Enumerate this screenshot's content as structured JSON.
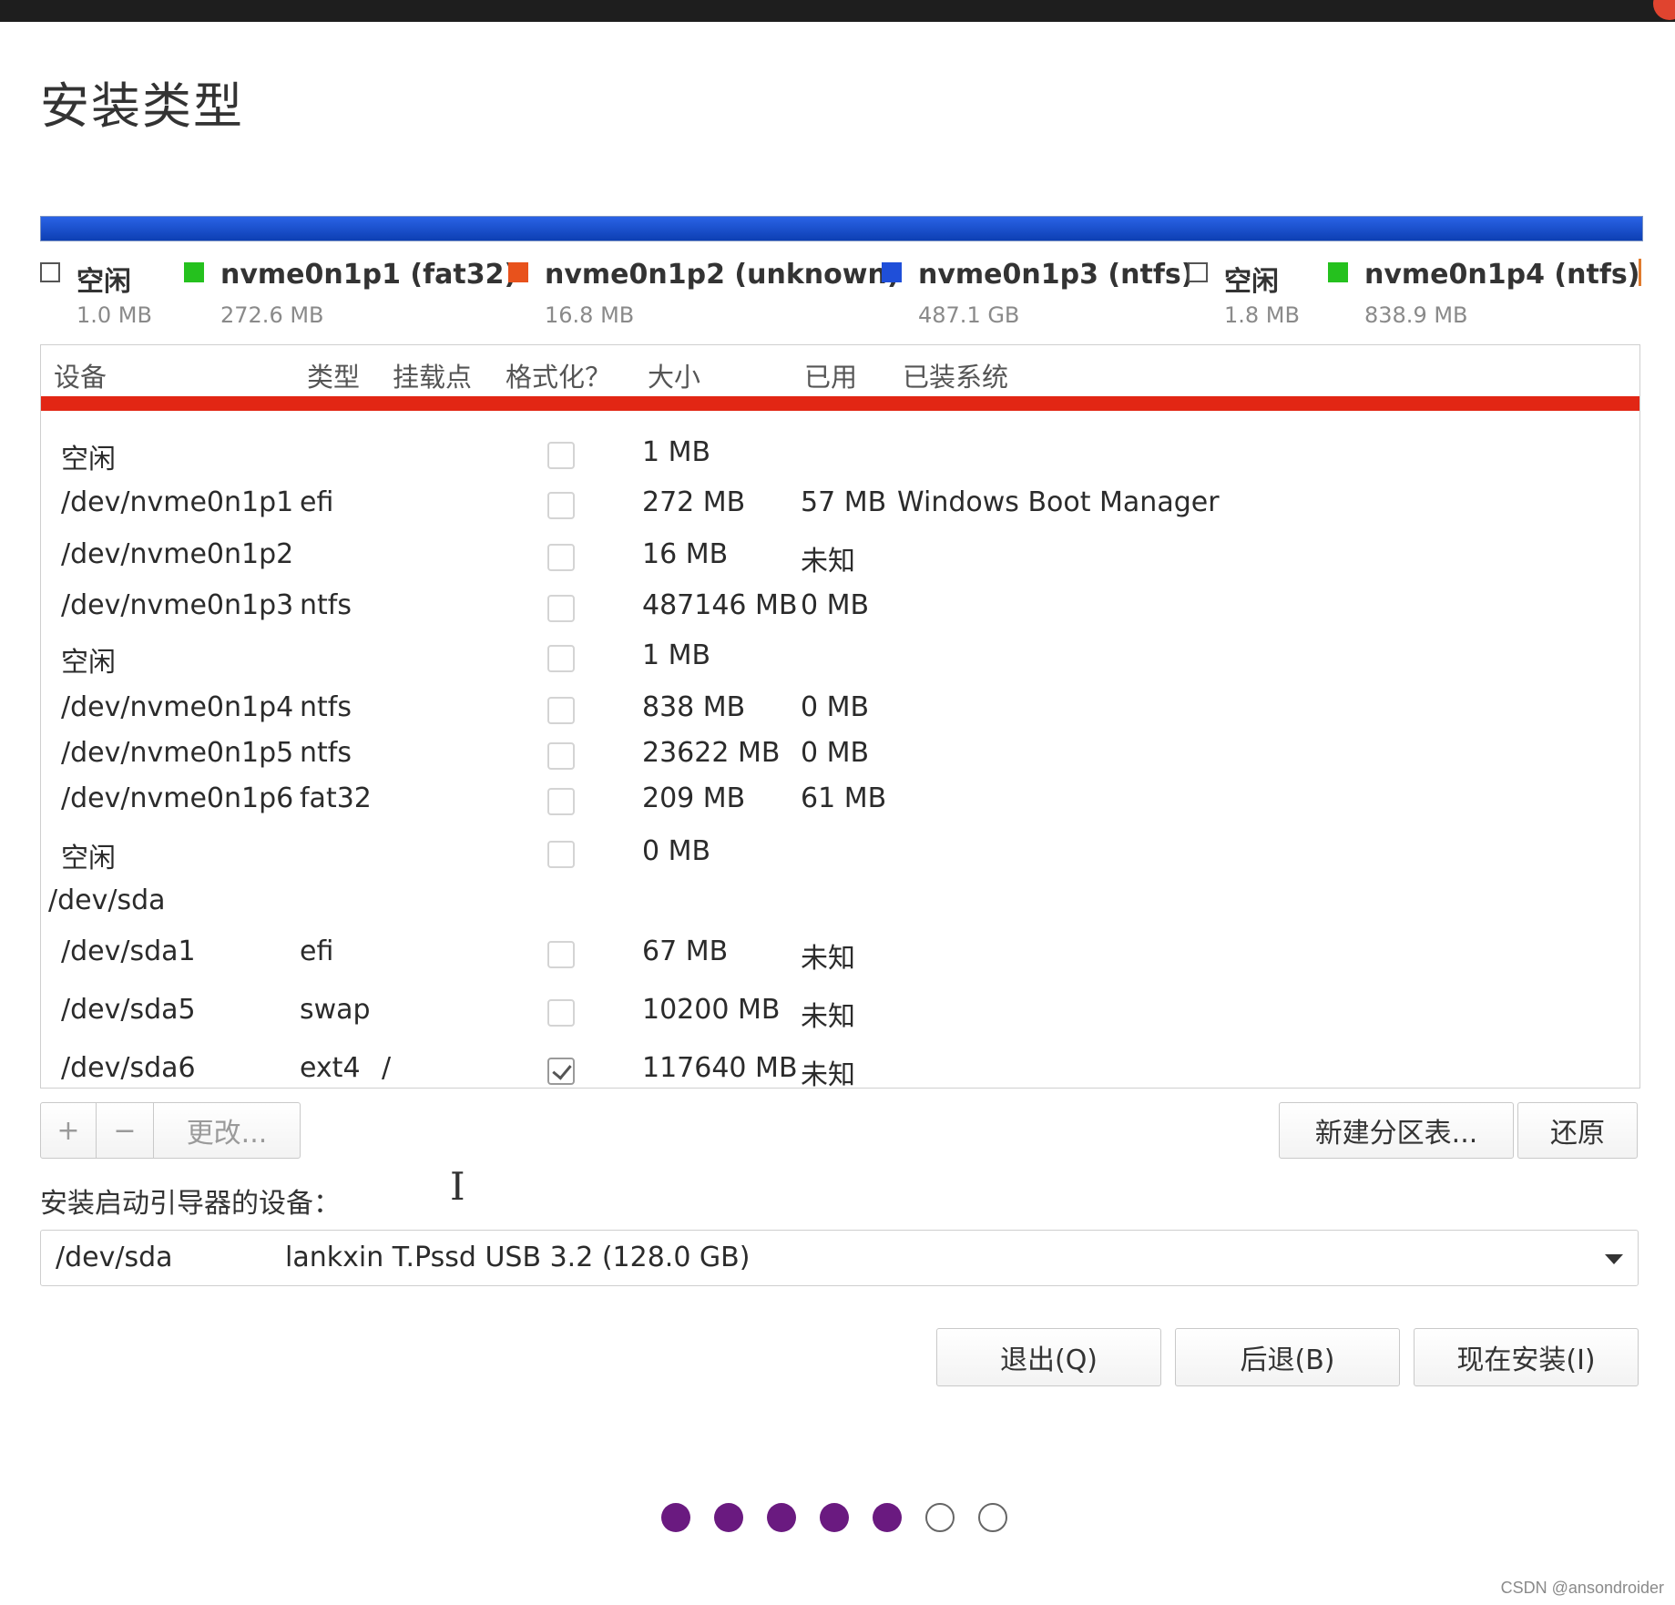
{
  "page": {
    "title": "安装类型"
  },
  "legend": [
    {
      "label": "空闲",
      "size": "1.0 MB",
      "color": "#ffffff",
      "free": true
    },
    {
      "label": "nvme0n1p1 (fat32)",
      "size": "272.6 MB",
      "color": "#25c11e",
      "free": false
    },
    {
      "label": "nvme0n1p2 (unknown)",
      "size": "16.8 MB",
      "color": "#e8521c",
      "free": false
    },
    {
      "label": "nvme0n1p3 (ntfs)",
      "size": "487.1 GB",
      "color": "#1f4fd9",
      "free": false
    },
    {
      "label": "空闲",
      "size": "1.8 MB",
      "color": "#ffffff",
      "free": true
    },
    {
      "label": "nvme0n1p4 (ntfs)",
      "size": "838.9 MB",
      "color": "#25c11e",
      "free": false
    }
  ],
  "table": {
    "headers": {
      "device": "设备",
      "type": "类型",
      "mount": "挂载点",
      "format": "格式化？",
      "size": "大小",
      "used": "已用",
      "system": "已装系统"
    },
    "rows": [
      {
        "device": "空闲",
        "type": "",
        "mount": "",
        "format": false,
        "size": "1 MB",
        "used": "",
        "system": ""
      },
      {
        "device": "/dev/nvme0n1p1",
        "type": "efi",
        "mount": "",
        "format": false,
        "size": "272 MB",
        "used": "57 MB",
        "system": "Windows Boot Manager"
      },
      {
        "device": "/dev/nvme0n1p2",
        "type": "",
        "mount": "",
        "format": false,
        "size": "16 MB",
        "used": "未知",
        "system": ""
      },
      {
        "device": "/dev/nvme0n1p3",
        "type": "ntfs",
        "mount": "",
        "format": false,
        "size": "487146 MB",
        "used": "0 MB",
        "system": ""
      },
      {
        "device": "空闲",
        "type": "",
        "mount": "",
        "format": false,
        "size": "1 MB",
        "used": "",
        "system": ""
      },
      {
        "device": "/dev/nvme0n1p4",
        "type": "ntfs",
        "mount": "",
        "format": false,
        "size": "838 MB",
        "used": "0 MB",
        "system": ""
      },
      {
        "device": "/dev/nvme0n1p5",
        "type": "ntfs",
        "mount": "",
        "format": false,
        "size": "23622 MB",
        "used": "0 MB",
        "system": ""
      },
      {
        "device": "/dev/nvme0n1p6",
        "type": "fat32",
        "mount": "",
        "format": false,
        "size": "209 MB",
        "used": "61 MB",
        "system": ""
      },
      {
        "device": "空闲",
        "type": "",
        "mount": "",
        "format": false,
        "size": "0 MB",
        "used": "",
        "system": ""
      },
      {
        "device": "/dev/sda",
        "type": "",
        "mount": "",
        "format": null,
        "size": "",
        "used": "",
        "system": "",
        "is_disk": true
      },
      {
        "device": "/dev/sda1",
        "type": "efi",
        "mount": "",
        "format": false,
        "size": "67 MB",
        "used": "未知",
        "system": ""
      },
      {
        "device": "/dev/sda5",
        "type": "swap",
        "mount": "",
        "format": false,
        "size": "10200 MB",
        "used": "未知",
        "system": ""
      },
      {
        "device": "/dev/sda6",
        "type": "ext4",
        "mount": "/",
        "format": true,
        "size": "117640 MB",
        "used": "未知",
        "system": ""
      }
    ]
  },
  "toolbar": {
    "add_label": "+",
    "remove_label": "−",
    "change_label": "更改...",
    "new_table_label": "新建分区表...",
    "revert_label": "还原"
  },
  "bootloader": {
    "label": "安装启动引导器的设备：",
    "device": "/dev/sda",
    "name": "lankxin T.Pssd USB 3.2 (128.0 GB)"
  },
  "actions": {
    "quit_label": "退出(Q)",
    "back_label": "后退(B)",
    "install_label": "现在安装(I)"
  },
  "progress": {
    "filled_steps": 5,
    "total_steps": 7,
    "color": "#6a1a80"
  },
  "watermark": "CSDN @ansondroider"
}
